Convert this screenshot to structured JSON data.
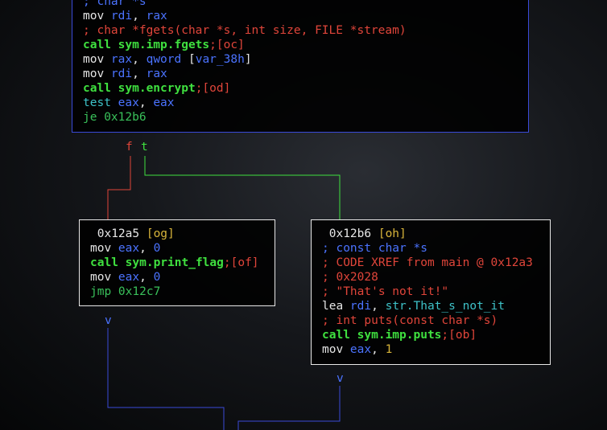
{
  "top_block": {
    "lines": [
      [
        {
          "t": "; char *s",
          "c": "b"
        }
      ],
      [
        {
          "t": "mov ",
          "c": "w"
        },
        {
          "t": "rdi",
          "c": "b"
        },
        {
          "t": ", ",
          "c": "w"
        },
        {
          "t": "rax",
          "c": "b"
        }
      ],
      [
        {
          "t": "; char *fgets(char *s, int size, FILE *stream)",
          "c": "r"
        }
      ],
      [
        {
          "t": "call sym.imp.fgets",
          "c": "g"
        },
        {
          "t": ";[oc]",
          "c": "r"
        }
      ],
      [
        {
          "t": "mov ",
          "c": "w"
        },
        {
          "t": "rax",
          "c": "b"
        },
        {
          "t": ", ",
          "c": "w"
        },
        {
          "t": "qword",
          "c": "b"
        },
        {
          "t": " [",
          "c": "w"
        },
        {
          "t": "var_38h",
          "c": "b"
        },
        {
          "t": "]",
          "c": "w"
        }
      ],
      [
        {
          "t": "mov ",
          "c": "w"
        },
        {
          "t": "rdi",
          "c": "b"
        },
        {
          "t": ", ",
          "c": "w"
        },
        {
          "t": "rax",
          "c": "b"
        }
      ],
      [
        {
          "t": "call sym.encrypt",
          "c": "g"
        },
        {
          "t": ";[od]",
          "c": "r"
        }
      ],
      [
        {
          "t": "test ",
          "c": "c"
        },
        {
          "t": "eax",
          "c": "b"
        },
        {
          "t": ", ",
          "c": "w"
        },
        {
          "t": "eax",
          "c": "b"
        }
      ],
      [
        {
          "t": "je 0x12b6",
          "c": "g2"
        }
      ]
    ]
  },
  "branch_labels": {
    "false": "f",
    "true": "t"
  },
  "left_block": {
    "lines": [
      [
        {
          "t": " 0x12a5 ",
          "c": "w"
        },
        {
          "t": "[og]",
          "c": "y"
        }
      ],
      [
        {
          "t": "mov ",
          "c": "w"
        },
        {
          "t": "eax",
          "c": "b"
        },
        {
          "t": ", ",
          "c": "w"
        },
        {
          "t": "0",
          "c": "b"
        }
      ],
      [
        {
          "t": "call sym.print_flag",
          "c": "g"
        },
        {
          "t": ";[of]",
          "c": "r"
        }
      ],
      [
        {
          "t": "mov ",
          "c": "w"
        },
        {
          "t": "eax",
          "c": "b"
        },
        {
          "t": ", ",
          "c": "w"
        },
        {
          "t": "0",
          "c": "b"
        }
      ],
      [
        {
          "t": "jmp 0x12c7",
          "c": "g2"
        }
      ]
    ]
  },
  "right_block": {
    "lines": [
      [
        {
          "t": " 0x12b6 ",
          "c": "w"
        },
        {
          "t": "[oh]",
          "c": "y"
        }
      ],
      [
        {
          "t": "; const char *s",
          "c": "b"
        }
      ],
      [
        {
          "t": "; CODE XREF from main @ 0x12a3",
          "c": "r"
        }
      ],
      [
        {
          "t": "; 0x2028",
          "c": "r"
        }
      ],
      [
        {
          "t": "; \"That's not it!\"",
          "c": "r"
        }
      ],
      [
        {
          "t": "lea ",
          "c": "w"
        },
        {
          "t": "rdi",
          "c": "b"
        },
        {
          "t": ", ",
          "c": "w"
        },
        {
          "t": "str.That_s_not_it",
          "c": "c"
        }
      ],
      [
        {
          "t": "; int puts(const char *s)",
          "c": "r"
        }
      ],
      [
        {
          "t": "call sym.imp.puts",
          "c": "g"
        },
        {
          "t": ";[ob]",
          "c": "r"
        }
      ],
      [
        {
          "t": "mov ",
          "c": "w"
        },
        {
          "t": "eax",
          "c": "b"
        },
        {
          "t": ", ",
          "c": "w"
        },
        {
          "t": "1",
          "c": "y"
        }
      ]
    ]
  },
  "edge_markers": {
    "left": "v",
    "right": "v"
  },
  "colors": {
    "w": "#e6e6e6",
    "b": "#4b73ff",
    "r": "#e0453a",
    "g": "#3fe03f",
    "g2": "#39c05a",
    "c": "#3ec2c8",
    "y": "#d8b43a",
    "edge_false": "#e0453a",
    "edge_true": "#3fe03f",
    "edge_jump": "#3a4ad8"
  }
}
